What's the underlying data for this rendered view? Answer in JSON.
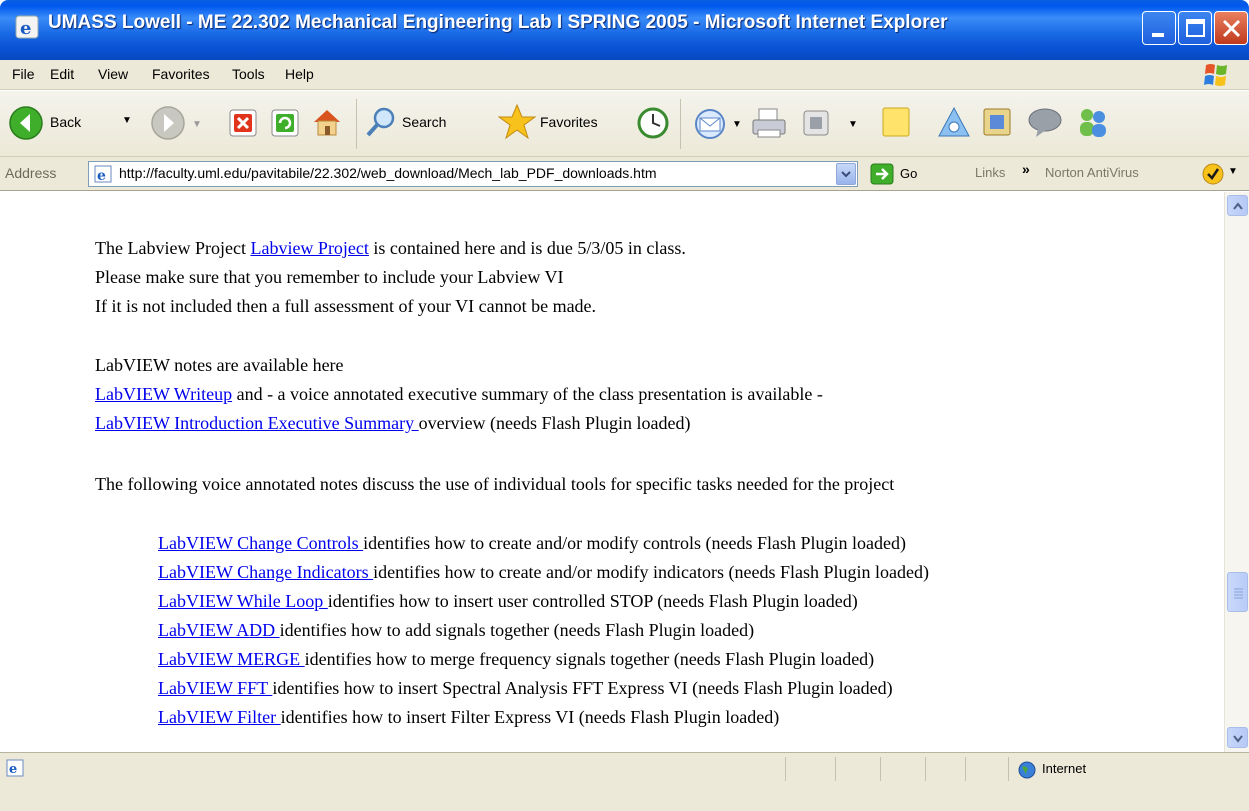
{
  "window": {
    "title": "UMASS Lowell - ME 22.302 Mechanical Engineering Lab I SPRING 2005 - Microsoft Internet Explorer"
  },
  "menu": {
    "file": "File",
    "edit": "Edit",
    "view": "View",
    "favorites": "Favorites",
    "tools": "Tools",
    "help": "Help"
  },
  "toolbar": {
    "back": "Back",
    "search": "Search",
    "favorites": "Favorites"
  },
  "address": {
    "label": "Address",
    "url": "http://faculty.uml.edu/pavitabile/22.302/web_download/Mech_lab_PDF_downloads.htm",
    "go": "Go",
    "links": "Links",
    "norton": "Norton AntiVirus"
  },
  "content": {
    "para1": {
      "line1_before": "The Labview Project ",
      "line1_link": "Labview Project",
      "line1_after": " is contained here and is due 5/3/05 in class.",
      "line2": "Please make sure that you remember to include your Labview VI",
      "line3": "If it is not included then a full assessment of your VI cannot be made."
    },
    "para2": {
      "line1": "LabVIEW notes are available here",
      "writeup_link": "LabVIEW Writeup",
      "writeup_after": " and - a voice annotated executive summary of the class presentation is available -",
      "summary_link": "LabVIEW Introduction Executive Summary ",
      "summary_after": "overview (needs Flash Plugin loaded)"
    },
    "para3": "The following voice annotated notes discuss the use of individual tools for specific tasks needed for the project",
    "tools": [
      {
        "link": "LabVIEW Change Controls ",
        "desc": "identifies how to create and/or modify controls (needs Flash Plugin loaded)"
      },
      {
        "link": "LabVIEW Change Indicators ",
        "desc": "identifies how to create and/or modify indicators (needs Flash Plugin loaded)"
      },
      {
        "link": "LabVIEW While Loop ",
        "desc": "identifies how to insert user controlled STOP (needs Flash Plugin loaded)"
      },
      {
        "link": "LabVIEW ADD ",
        "desc": "identifies how to add signals together (needs Flash Plugin loaded)"
      },
      {
        "link": "LabVIEW MERGE ",
        "desc": "identifies how to merge frequency signals together (needs Flash Plugin loaded)"
      },
      {
        "link": "LabVIEW FFT ",
        "desc": "identifies how to insert Spectral Analysis FFT Express VI (needs Flash Plugin loaded)"
      },
      {
        "link": "LabVIEW Filter ",
        "desc": "identifies how to insert Filter Express VI (needs Flash Plugin loaded)"
      }
    ]
  },
  "status": {
    "zone": "Internet"
  },
  "colors": {
    "titlebar": "#0A5FE0",
    "chrome": "#ECE9D8",
    "link": "#0000EE"
  },
  "icons": [
    "ie-icon",
    "minimize-icon",
    "maximize-icon",
    "close-icon",
    "windows-logo-icon",
    "back-icon",
    "forward-icon",
    "stop-icon",
    "refresh-icon",
    "home-icon",
    "search-icon",
    "favorites-star-icon",
    "history-icon",
    "mail-icon",
    "print-icon",
    "edit-icon",
    "notes-icon",
    "research-icon",
    "messenger-icon",
    "discuss-icon",
    "users-icon",
    "page-icon",
    "go-arrow-icon",
    "norton-icon",
    "internet-zone-icon"
  ]
}
